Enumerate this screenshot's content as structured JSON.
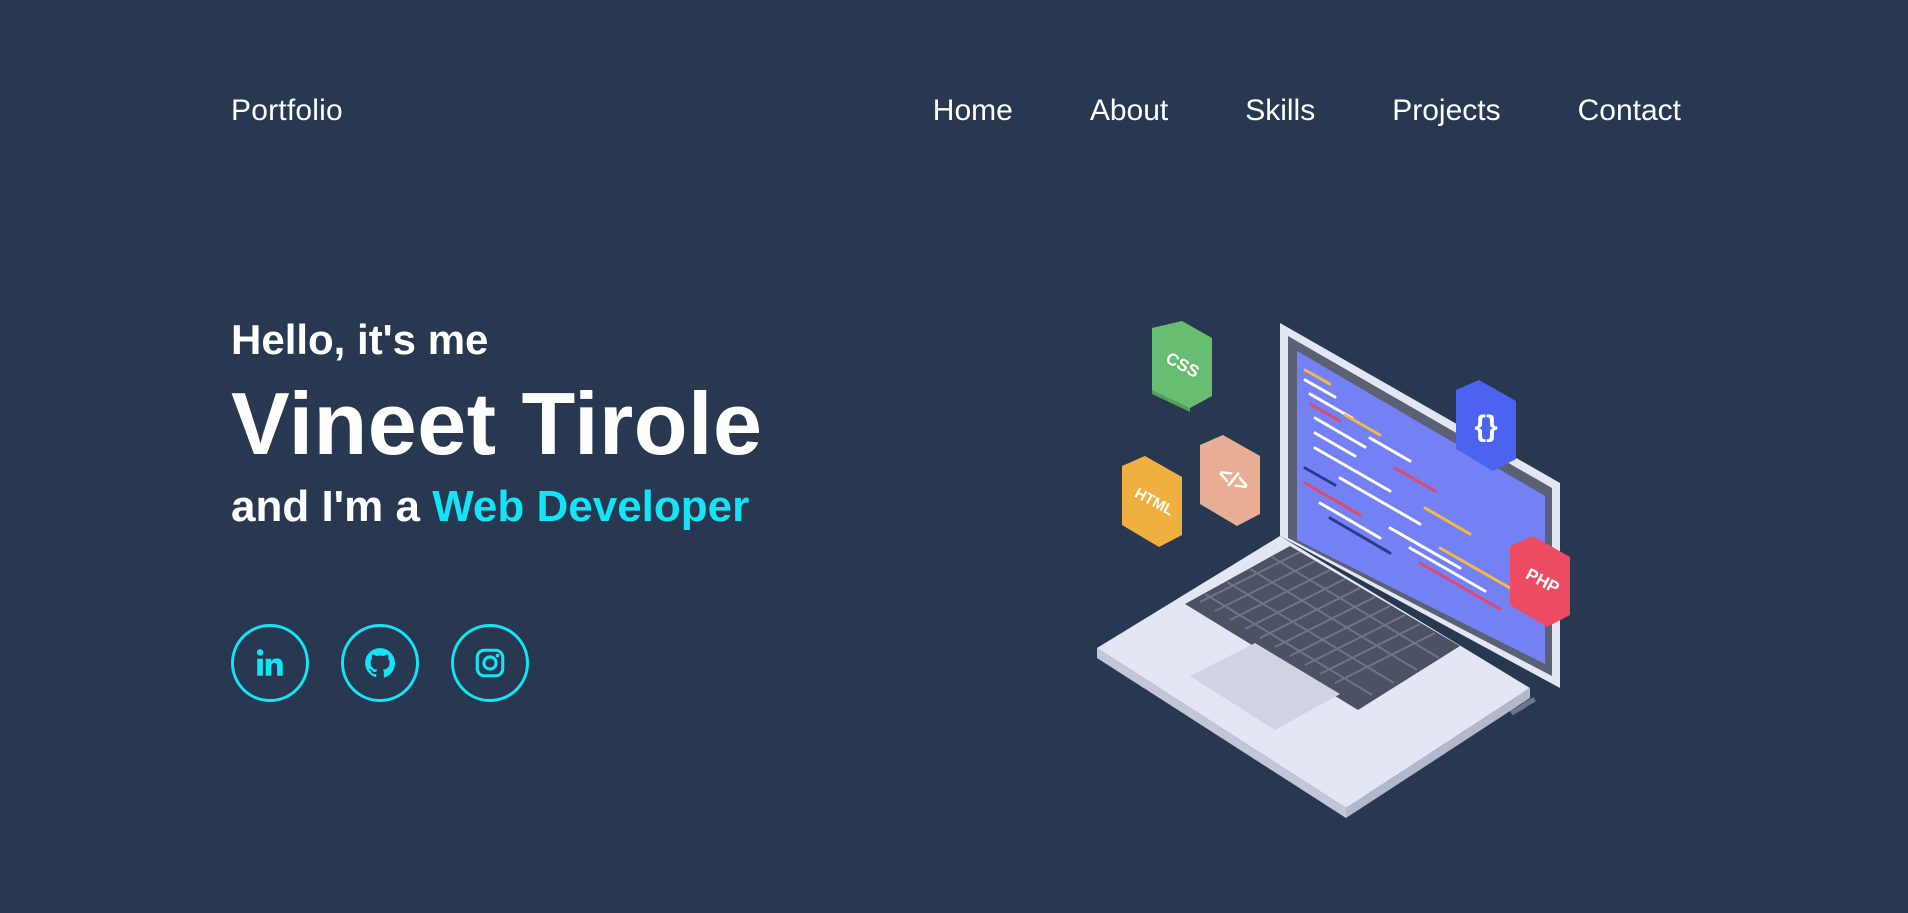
{
  "header": {
    "logo": "Portfolio",
    "nav": [
      "Home",
      "About",
      "Skills",
      "Projects",
      "Contact"
    ]
  },
  "hero": {
    "greeting": "Hello, it's me",
    "name": "Vineet Tirole",
    "role_prefix": "and I'm a ",
    "role_highlight": "Web Developer"
  },
  "socials": [
    "linkedin-icon",
    "github-icon",
    "instagram-icon"
  ],
  "illustration": {
    "badges": [
      "CSS",
      "</>",
      "HTML",
      "{}",
      "PHP"
    ]
  },
  "colors": {
    "background": "#283850",
    "accent": "#15e3f6",
    "text": "#ffffff"
  }
}
